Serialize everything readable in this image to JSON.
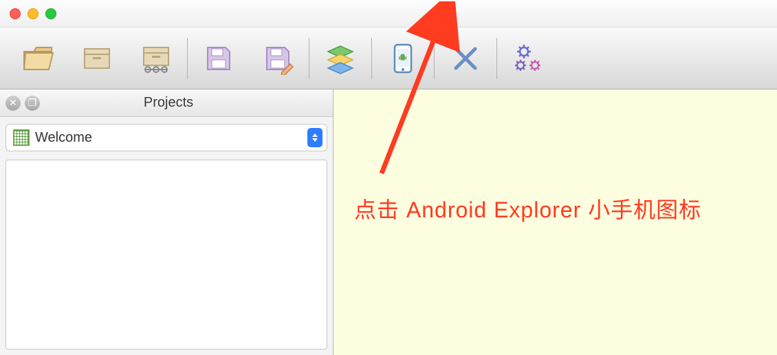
{
  "titlebar": {},
  "toolbar": {
    "items": [
      {
        "name": "open-folder"
      },
      {
        "name": "archive-box"
      },
      {
        "name": "archive-export"
      }
    ],
    "group2": [
      {
        "name": "save-floppy"
      },
      {
        "name": "save-edit"
      }
    ],
    "group3": [
      {
        "name": "layers"
      }
    ],
    "group4": [
      {
        "name": "android-explorer"
      }
    ],
    "group5": [
      {
        "name": "stop-x"
      }
    ],
    "group6": [
      {
        "name": "settings-gears"
      }
    ]
  },
  "panel": {
    "title": "Projects",
    "dropdown_value": "Welcome"
  },
  "annotation": {
    "text": "点击 Android Explorer 小手机图标"
  }
}
